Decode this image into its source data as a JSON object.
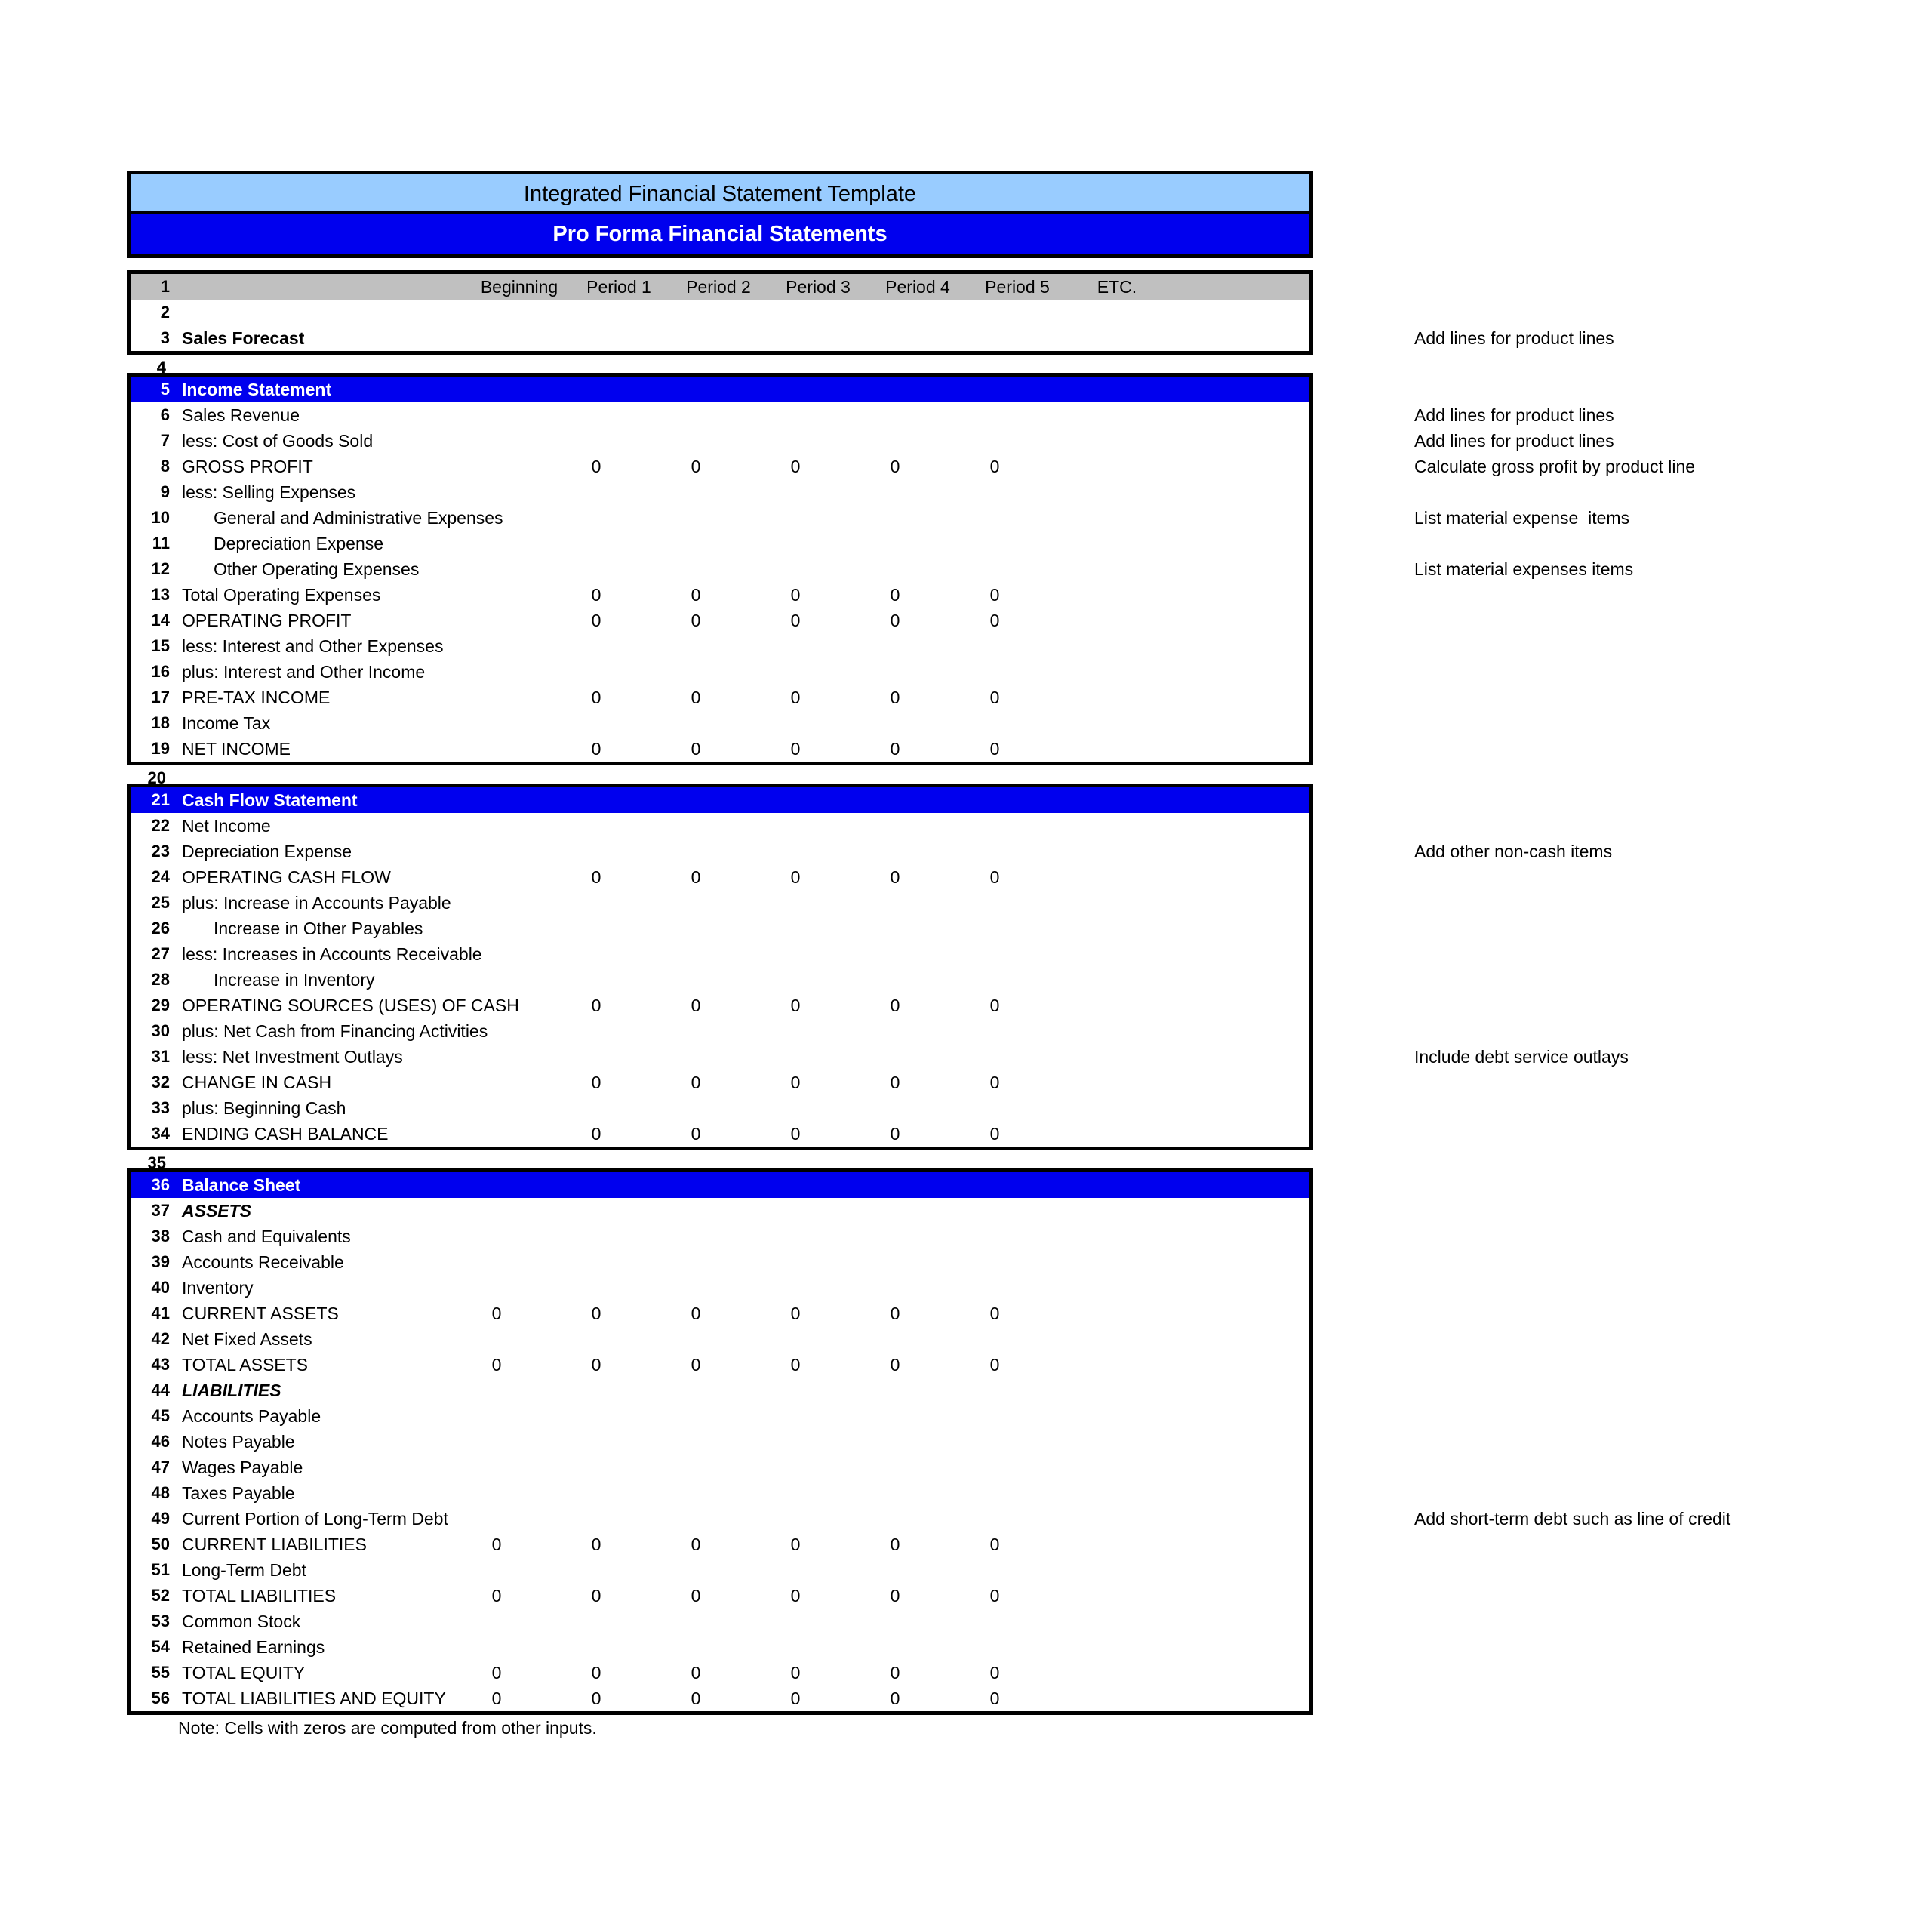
{
  "title": {
    "template_name": "Integrated Financial Statement Template",
    "subtitle": "Pro Forma Financial Statements"
  },
  "colors": {
    "banner_light": "#99ccff",
    "banner_blue": "#0000ee",
    "section_header_blue": "#0000ee",
    "column_header_gray": "#c0c0c0",
    "text": "#000000",
    "header_text": "#ffffff"
  },
  "column_headers": [
    "Beginning",
    "Period 1",
    "Period 2",
    "Period 3",
    "Period 4",
    "Period 5",
    "ETC."
  ],
  "sections": {
    "sales_forecast": {
      "rows": [
        {
          "num": "1",
          "label": "",
          "kind": "header-gray"
        },
        {
          "num": "2",
          "label": "",
          "kind": "plain"
        },
        {
          "num": "3",
          "label": "Sales Forecast",
          "kind": "bold"
        }
      ]
    },
    "spacer_row_4": {
      "num": "4",
      "label": ""
    },
    "income_statement": {
      "rows": [
        {
          "num": "5",
          "label": "Income Statement",
          "kind": "section",
          "values": []
        },
        {
          "num": "6",
          "label": "Sales Revenue",
          "kind": "plain",
          "values": []
        },
        {
          "num": "7",
          "label": "less: Cost of Goods Sold",
          "kind": "plain",
          "values": []
        },
        {
          "num": "8",
          "label": "GROSS PROFIT",
          "kind": "plain",
          "values": [
            "0",
            "0",
            "0",
            "0",
            "0"
          ]
        },
        {
          "num": "9",
          "label": "less: Selling Expenses",
          "kind": "plain",
          "values": []
        },
        {
          "num": "10",
          "label": "General and Administrative Expenses",
          "kind": "indent",
          "values": []
        },
        {
          "num": "11",
          "label": "Depreciation Expense",
          "kind": "indent",
          "values": []
        },
        {
          "num": "12",
          "label": "Other Operating Expenses",
          "kind": "indent",
          "values": []
        },
        {
          "num": "13",
          "label": "Total Operating Expenses",
          "kind": "plain",
          "values": [
            "0",
            "0",
            "0",
            "0",
            "0"
          ]
        },
        {
          "num": "14",
          "label": "OPERATING PROFIT",
          "kind": "plain",
          "values": [
            "0",
            "0",
            "0",
            "0",
            "0"
          ]
        },
        {
          "num": "15",
          "label": "less: Interest and Other Expenses",
          "kind": "plain",
          "values": []
        },
        {
          "num": "16",
          "label": "plus: Interest and Other Income",
          "kind": "plain",
          "values": []
        },
        {
          "num": "17",
          "label": "PRE-TAX INCOME",
          "kind": "plain",
          "values": [
            "0",
            "0",
            "0",
            "0",
            "0"
          ]
        },
        {
          "num": "18",
          "label": "Income Tax",
          "kind": "plain",
          "values": []
        },
        {
          "num": "19",
          "label": "NET INCOME",
          "kind": "plain",
          "values": [
            "0",
            "0",
            "0",
            "0",
            "0"
          ]
        }
      ]
    },
    "spacer_row_20": {
      "num": "20",
      "label": ""
    },
    "cash_flow_statement": {
      "rows": [
        {
          "num": "21",
          "label": "Cash Flow Statement",
          "kind": "section",
          "values": []
        },
        {
          "num": "22",
          "label": "Net Income",
          "kind": "plain",
          "values": []
        },
        {
          "num": "23",
          "label": "Depreciation Expense",
          "kind": "plain",
          "values": []
        },
        {
          "num": "24",
          "label": "OPERATING CASH FLOW",
          "kind": "plain",
          "values": [
            "0",
            "0",
            "0",
            "0",
            "0"
          ]
        },
        {
          "num": "25",
          "label": "plus: Increase in Accounts Payable",
          "kind": "plain",
          "values": []
        },
        {
          "num": "26",
          "label": "Increase in Other Payables",
          "kind": "indent",
          "values": []
        },
        {
          "num": "27",
          "label": "less: Increases in Accounts Receivable",
          "kind": "plain",
          "values": []
        },
        {
          "num": "28",
          "label": "Increase in Inventory",
          "kind": "indent",
          "values": []
        },
        {
          "num": "29",
          "label": "OPERATING SOURCES (USES) OF CASH",
          "kind": "plain",
          "values": [
            "0",
            "0",
            "0",
            "0",
            "0"
          ]
        },
        {
          "num": "30",
          "label": "plus: Net Cash from Financing Activities",
          "kind": "plain",
          "values": []
        },
        {
          "num": "31",
          "label": "less: Net Investment Outlays",
          "kind": "plain",
          "values": []
        },
        {
          "num": "32",
          "label": "CHANGE IN CASH",
          "kind": "plain",
          "values": [
            "0",
            "0",
            "0",
            "0",
            "0"
          ]
        },
        {
          "num": "33",
          "label": "plus: Beginning Cash",
          "kind": "plain",
          "values": []
        },
        {
          "num": "34",
          "label": "ENDING CASH BALANCE",
          "kind": "plain",
          "values": [
            "0",
            "0",
            "0",
            "0",
            "0"
          ]
        }
      ]
    },
    "spacer_row_35": {
      "num": "35",
      "label": ""
    },
    "balance_sheet": {
      "rows": [
        {
          "num": "36",
          "label": "Balance Sheet",
          "kind": "section",
          "values": []
        },
        {
          "num": "37",
          "label": "ASSETS",
          "kind": "italic",
          "values": []
        },
        {
          "num": "38",
          "label": "Cash and Equivalents",
          "kind": "plain",
          "values": []
        },
        {
          "num": "39",
          "label": "Accounts Receivable",
          "kind": "plain",
          "values": []
        },
        {
          "num": "40",
          "label": "Inventory",
          "kind": "plain",
          "values": []
        },
        {
          "num": "41",
          "label": "CURRENT ASSETS",
          "kind": "plain",
          "values": [
            "0",
            "0",
            "0",
            "0",
            "0",
            "0"
          ]
        },
        {
          "num": "42",
          "label": "Net Fixed Assets",
          "kind": "plain",
          "values": []
        },
        {
          "num": "43",
          "label": "TOTAL ASSETS",
          "kind": "plain",
          "values": [
            "0",
            "0",
            "0",
            "0",
            "0",
            "0"
          ]
        },
        {
          "num": "44",
          "label": "LIABILITIES",
          "kind": "italic",
          "values": []
        },
        {
          "num": "45",
          "label": "Accounts Payable",
          "kind": "plain",
          "values": []
        },
        {
          "num": "46",
          "label": "Notes Payable",
          "kind": "plain",
          "values": []
        },
        {
          "num": "47",
          "label": "Wages Payable",
          "kind": "plain",
          "values": []
        },
        {
          "num": "48",
          "label": "Taxes Payable",
          "kind": "plain",
          "values": []
        },
        {
          "num": "49",
          "label": "Current Portion of Long-Term Debt",
          "kind": "plain",
          "values": []
        },
        {
          "num": "50",
          "label": "CURRENT LIABILITIES",
          "kind": "plain",
          "values": [
            "0",
            "0",
            "0",
            "0",
            "0",
            "0"
          ]
        },
        {
          "num": "51",
          "label": "Long-Term Debt",
          "kind": "plain",
          "values": []
        },
        {
          "num": "52",
          "label": "TOTAL LIABILITIES",
          "kind": "plain",
          "values": [
            "0",
            "0",
            "0",
            "0",
            "0",
            "0"
          ]
        },
        {
          "num": "53",
          "label": "Common Stock",
          "kind": "plain",
          "values": []
        },
        {
          "num": "54",
          "label": "Retained Earnings",
          "kind": "plain",
          "values": []
        },
        {
          "num": "55",
          "label": "TOTAL EQUITY",
          "kind": "plain",
          "values": [
            "0",
            "0",
            "0",
            "0",
            "0",
            "0"
          ]
        },
        {
          "num": "56",
          "label": "TOTAL LIABILITIES AND EQUITY",
          "kind": "plain",
          "values": [
            "0",
            "0",
            "0",
            "0",
            "0",
            "0"
          ]
        }
      ]
    }
  },
  "annotations": [
    {
      "row": "3",
      "text": "Add lines for product lines"
    },
    {
      "row": "6",
      "text": "Add lines for product lines"
    },
    {
      "row": "7",
      "text": "Add lines for product lines"
    },
    {
      "row": "8",
      "text": "Calculate gross profit by product line"
    },
    {
      "row": "10",
      "text": "List material expense  items"
    },
    {
      "row": "12",
      "text": "List material expenses items"
    },
    {
      "row": "23",
      "text": "Add other non-cash items"
    },
    {
      "row": "31",
      "text": "Include debt service outlays"
    },
    {
      "row": "49",
      "text": "Add short-term debt such as line of credit"
    }
  ],
  "footnote": "Note: Cells with zeros are computed from other inputs."
}
